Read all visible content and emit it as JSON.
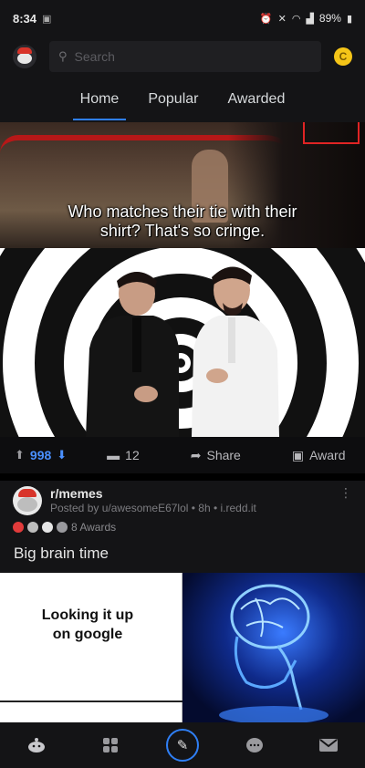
{
  "status_bar": {
    "time": "8:34",
    "battery": "89%"
  },
  "header": {
    "search_placeholder": "Search",
    "coin_label": "C"
  },
  "tabs": [
    {
      "label": "Home",
      "active": true
    },
    {
      "label": "Popular",
      "active": false
    },
    {
      "label": "Awarded",
      "active": false
    }
  ],
  "post1": {
    "caption_line1": "Who matches their tie with their",
    "caption_line2": "shirt? That's so cringe.",
    "vote_count": "998",
    "comment_count": "12",
    "share_label": "Share",
    "award_label": "Award"
  },
  "post2": {
    "subreddit": "r/memes",
    "meta": "Posted by u/awesomeE67lol • 8h • i.redd.it",
    "awards_count": "8 Awards",
    "title": "Big brain time",
    "meme_text": "Looking it up on google"
  },
  "colors": {
    "accent": "#2f7ff5",
    "upvote_blue": "#4a90ff",
    "background": "#0d0d0f",
    "panel": "#141416"
  },
  "icons": {
    "header_avatar": "snoo-avatar-icon",
    "search": "search-icon",
    "coin": "coin-icon",
    "upvote": "arrow-up-icon",
    "downvote": "arrow-down-icon",
    "comment": "comment-icon",
    "share": "share-icon",
    "award": "gift-icon",
    "more": "more-vertical-icon",
    "nav": [
      "home-icon",
      "communities-icon",
      "create-post-icon",
      "chat-icon",
      "inbox-icon"
    ]
  }
}
